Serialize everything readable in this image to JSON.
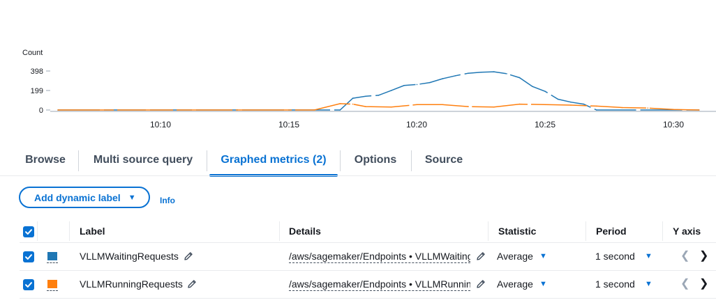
{
  "chart": {
    "unit_label": "Count",
    "y_ticks": [
      "398",
      "199",
      "0"
    ],
    "x_ticks": [
      "10:10",
      "10:15",
      "10:20",
      "10:25",
      "10:30"
    ]
  },
  "chart_data": {
    "type": "line",
    "ylabel": "Count",
    "ylim": [
      0,
      398
    ],
    "x_range": [
      "10:06",
      "10:31"
    ],
    "grid": false,
    "series": [
      {
        "name": "VLLMWaitingRequests",
        "color": "#1f77b4",
        "x": [
          "10:06",
          "10:17",
          "10:17:30",
          "10:18",
          "10:18:30",
          "10:19",
          "10:19:30",
          "10:20",
          "10:20:30",
          "10:21",
          "10:21:30",
          "10:22",
          "10:22:30",
          "10:23",
          "10:23:30",
          "10:24",
          "10:24:30",
          "10:25",
          "10:25:30",
          "10:26",
          "10:26:30",
          "10:27",
          "10:31"
        ],
        "y": [
          0,
          0,
          120,
          140,
          150,
          200,
          250,
          260,
          280,
          320,
          350,
          375,
          385,
          390,
          370,
          330,
          240,
          190,
          110,
          80,
          60,
          0,
          0
        ]
      },
      {
        "name": "VLLMRunningRequests",
        "color": "#ff7f0e",
        "x": [
          "10:06",
          "10:16",
          "10:17",
          "10:17:30",
          "10:18",
          "10:19",
          "10:20",
          "10:21",
          "10:22",
          "10:23",
          "10:24",
          "10:25",
          "10:26",
          "10:27",
          "10:28",
          "10:29",
          "10:30",
          "10:31"
        ],
        "y": [
          0,
          0,
          65,
          60,
          35,
          30,
          55,
          55,
          35,
          30,
          60,
          55,
          50,
          40,
          25,
          20,
          5,
          0
        ]
      }
    ]
  },
  "tabs": [
    {
      "label": "Browse"
    },
    {
      "label": "Multi source query"
    },
    {
      "label": "Graphed metrics (2)"
    },
    {
      "label": "Options"
    },
    {
      "label": "Source"
    }
  ],
  "actions": {
    "dynamic_label_button": "Add dynamic label",
    "info_link": "Info"
  },
  "table": {
    "headers": {
      "label": "Label",
      "details": "Details",
      "statistic": "Statistic",
      "period": "Period",
      "y_axis": "Y axis"
    },
    "rows": [
      {
        "label": "VLLMWaitingRequests",
        "color": "#1f77b4",
        "details": "/aws/sagemaker/Endpoints • VLLMWaitingRequests",
        "statistic": "Average",
        "period": "1 second"
      },
      {
        "label": "VLLMRunningRequests",
        "color": "#ff7f0e",
        "details": "/aws/sagemaker/Endpoints • VLLMRunningRequests",
        "statistic": "Average",
        "period": "1 second"
      }
    ]
  }
}
